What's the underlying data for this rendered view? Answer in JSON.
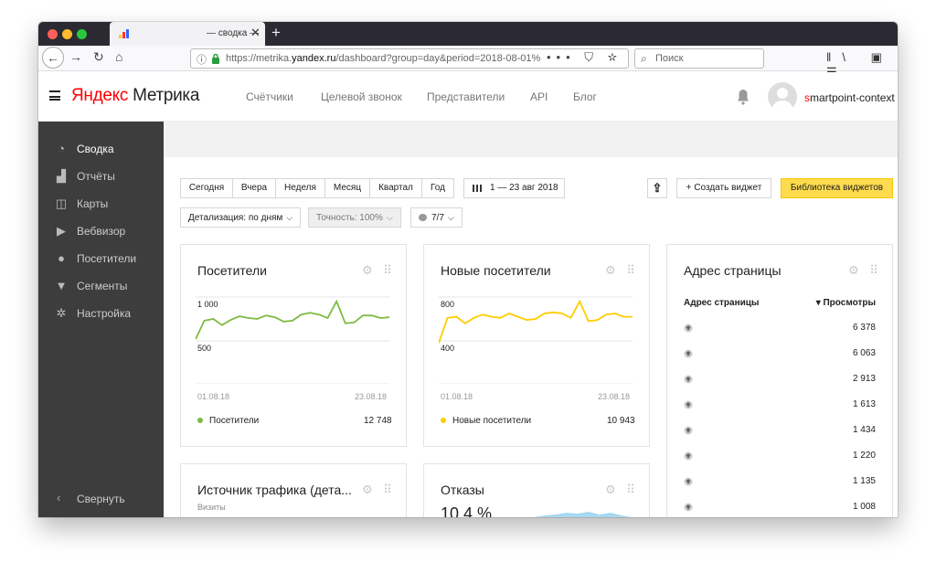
{
  "browser": {
    "tab_title": "— сводка —",
    "tab_close": "✕",
    "new_tab": "+",
    "url_prefix": "https://metrika.",
    "url_host": "yandex.ru",
    "url_path": "/dashboard?group=day&period=2018-08-01%",
    "url_actions": "••• ⛉ ☆",
    "search_placeholder": "Поиск",
    "tools": "ǁ\\ ▣ ☰"
  },
  "app": {
    "logo_part1": "Яндекс",
    "logo_part2": " Метрика",
    "nav": [
      "Счётчики",
      "Целевой звонок",
      "Представители",
      "API",
      "Блог"
    ],
    "user_first": "s",
    "user_rest": "martpoint-context"
  },
  "sidebar": {
    "items": [
      {
        "label": "Сводка",
        "icon": "◔"
      },
      {
        "label": "Отчёты",
        "icon": "▟"
      },
      {
        "label": "Карты",
        "icon": "◫"
      },
      {
        "label": "Вебвизор",
        "icon": "▶"
      },
      {
        "label": "Посетители",
        "icon": "●"
      },
      {
        "label": "Сегменты",
        "icon": "▼"
      },
      {
        "label": "Настройка",
        "icon": "✲"
      }
    ],
    "collapse_icon": "‹",
    "collapse_label": "Свернуть"
  },
  "toolbar": {
    "periods": [
      "Сегодня",
      "Вчера",
      "Неделя",
      "Месяц",
      "Квартал",
      "Год"
    ],
    "date_range": "1 — 23 авг 2018",
    "share_icon": "⇪",
    "create_widget": "+ Создать виджет",
    "library": "Библиотека виджетов",
    "detail": "Детализация: по дням",
    "accuracy": "Точность: 100%",
    "segments": "7/7",
    "chevron": "⌵"
  },
  "widgets": {
    "visitors": {
      "title": "Посетители",
      "y_top": "1 000",
      "y_bottom": "500",
      "x_start": "01.08.18",
      "x_end": "23.08.18",
      "legend": "Посетители",
      "total": "12 748",
      "color": "#7dbb42"
    },
    "new_visitors": {
      "title": "Новые посетители",
      "y_top": "800",
      "y_bottom": "400",
      "x_start": "01.08.18",
      "x_end": "23.08.18",
      "legend": "Новые посетители",
      "total": "10 943",
      "color": "#ffcc00"
    },
    "pages": {
      "title": "Адрес страницы",
      "col1": "Адрес страницы",
      "col2": "▾ Просмотры",
      "values": [
        "6 378",
        "6 063",
        "2 913",
        "1 613",
        "1 434",
        "1 220",
        "1 135",
        "1 008"
      ]
    },
    "traffic": {
      "title": "Источник трафика (дета...",
      "sub": "Визиты"
    },
    "bounces": {
      "title": "Отказы",
      "value": "10.4 %"
    },
    "icons": "⚙ ⠿"
  },
  "chart_data": [
    {
      "type": "line",
      "title": "Посетители",
      "x": [
        "01.08.18",
        "23.08.18"
      ],
      "ylim": [
        500,
        1000
      ],
      "series": [
        {
          "name": "Посетители",
          "values": [
            520,
            730,
            750,
            680,
            740,
            780,
            760,
            750,
            790,
            770,
            720,
            730,
            800,
            820,
            800,
            760,
            950,
            700,
            710,
            790,
            790,
            760,
            770
          ]
        }
      ]
    },
    {
      "type": "line",
      "title": "Новые посетители",
      "x": [
        "01.08.18",
        "23.08.18"
      ],
      "ylim": [
        400,
        800
      ],
      "series": [
        {
          "name": "Новые посетители",
          "values": [
            380,
            610,
            620,
            560,
            610,
            640,
            620,
            610,
            650,
            620,
            590,
            600,
            650,
            660,
            650,
            610,
            760,
            580,
            590,
            640,
            650,
            620,
            620
          ]
        }
      ]
    }
  ]
}
